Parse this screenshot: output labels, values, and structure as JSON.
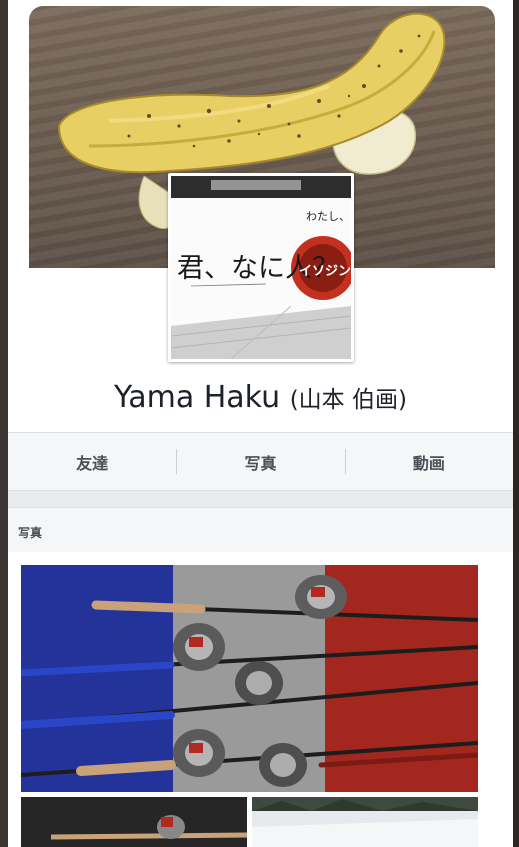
{
  "profile": {
    "name": "Yama Haku",
    "alternate_name": "(山本 伯画)"
  },
  "profile_picture": {
    "poster_text_main": "君、なに人？",
    "poster_text_small": "わたし、",
    "poster_logo_text": "イソジン"
  },
  "tabs": [
    {
      "label": "友達"
    },
    {
      "label": "写真"
    },
    {
      "label": "動画"
    }
  ],
  "photos_section": {
    "title": "写真"
  },
  "colors": {
    "flag_blue": "#1f2f9a",
    "flag_white": "#cfcfcf",
    "flag_red": "#a3271e",
    "logo_red": "#c3301f"
  }
}
